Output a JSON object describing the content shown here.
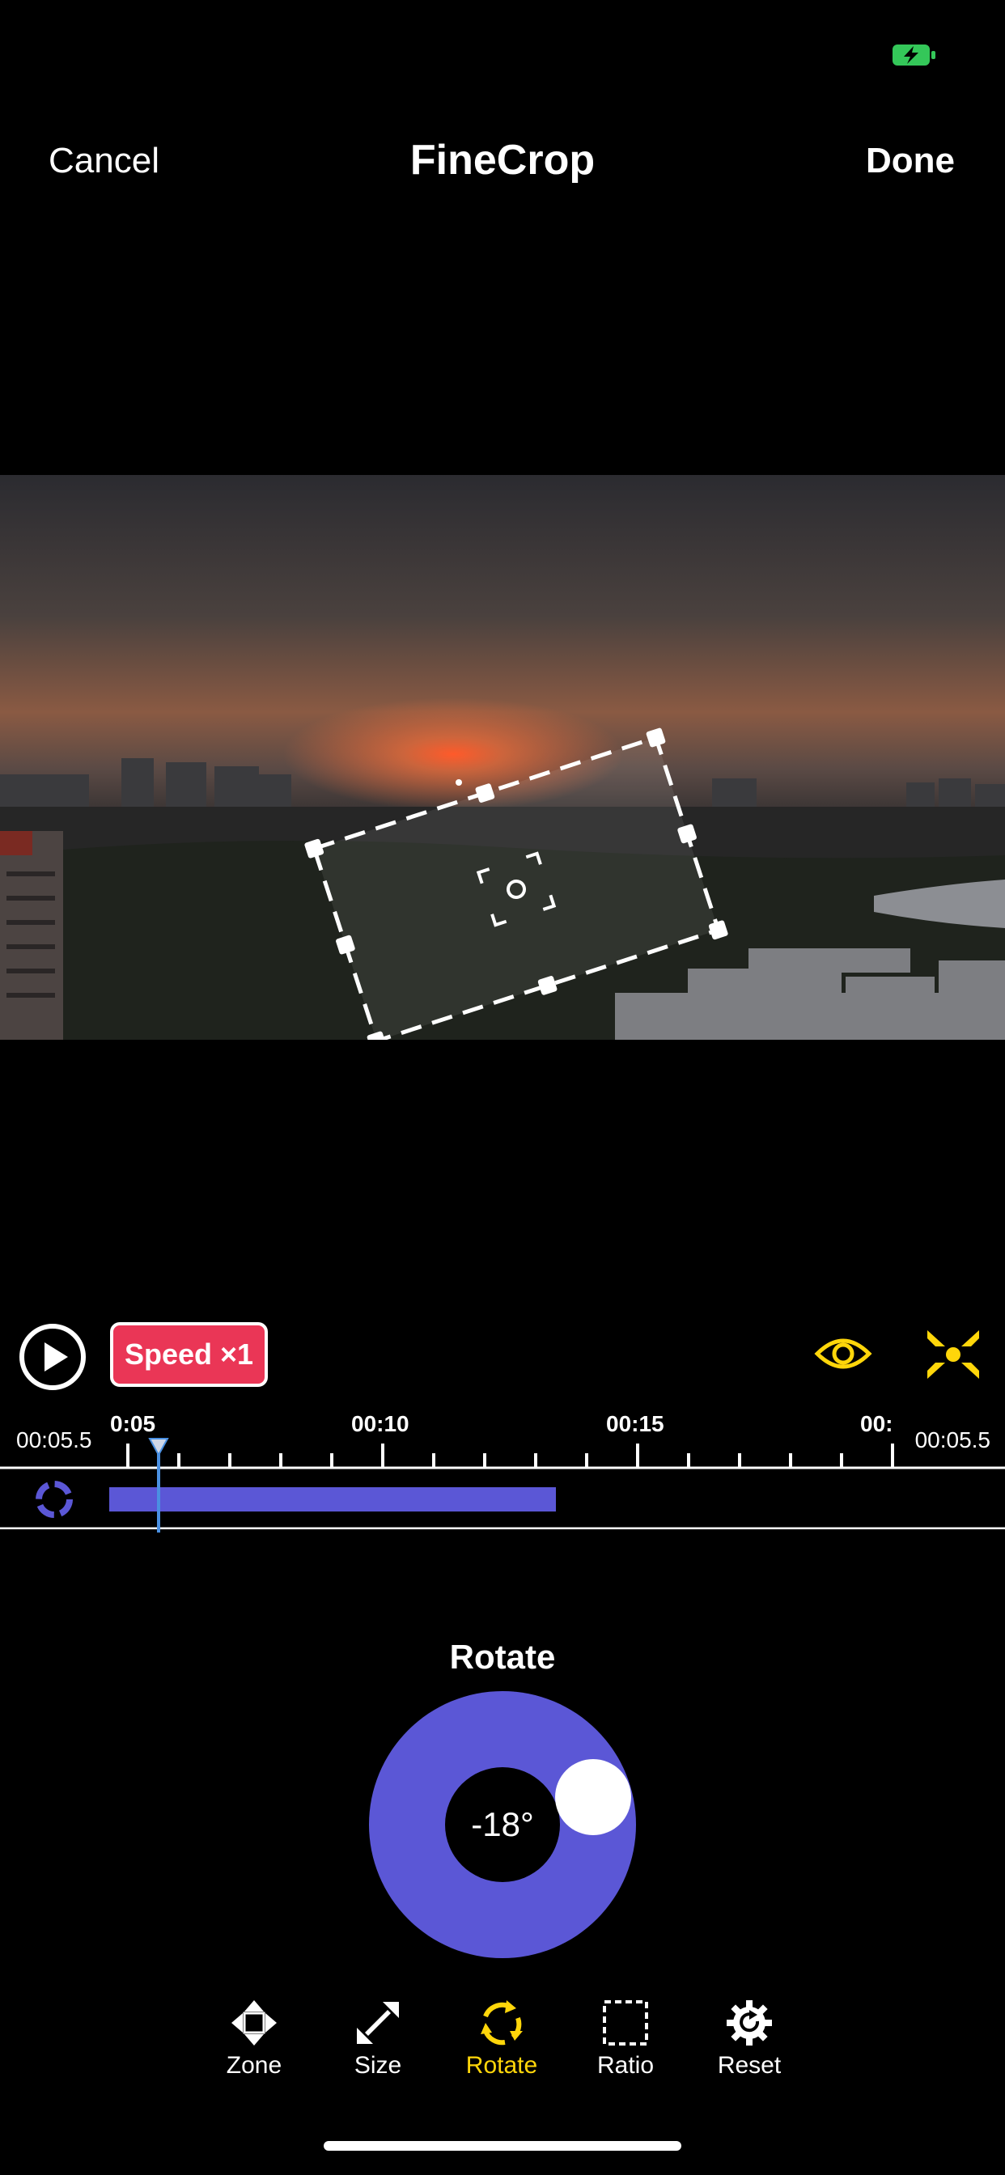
{
  "header": {
    "cancel_label": "Cancel",
    "title": "FineCrop",
    "done_label": "Done"
  },
  "status": {
    "battery_icon": "battery-charging-icon",
    "battery_color": "#34c759"
  },
  "controls": {
    "speed_label": "Speed ×1",
    "play_icon": "play-icon",
    "preview_icon": "eye-icon",
    "collapse_icon": "collapse-arrows-icon",
    "accent": "#ffd60a"
  },
  "timeline": {
    "start_time": "00:05.5",
    "end_time": "00:05.5",
    "ticks": [
      "0:05",
      "00:10",
      "00:15",
      "00:"
    ],
    "clip_color": "#5b57d6",
    "playhead_color": "#4a90e2"
  },
  "rotate_panel": {
    "title": "Rotate",
    "angle": "-18°",
    "angle_value": -18,
    "dial_color": "#5b57d6"
  },
  "toolbar": {
    "items": [
      {
        "label": "Zone",
        "icon": "move-arrows-icon",
        "active": false
      },
      {
        "label": "Size",
        "icon": "resize-arrows-icon",
        "active": false
      },
      {
        "label": "Rotate",
        "icon": "rotate-icon",
        "active": true
      },
      {
        "label": "Ratio",
        "icon": "ratio-frame-icon",
        "active": false
      },
      {
        "label": "Reset",
        "icon": "reset-gear-icon",
        "active": false
      }
    ]
  }
}
